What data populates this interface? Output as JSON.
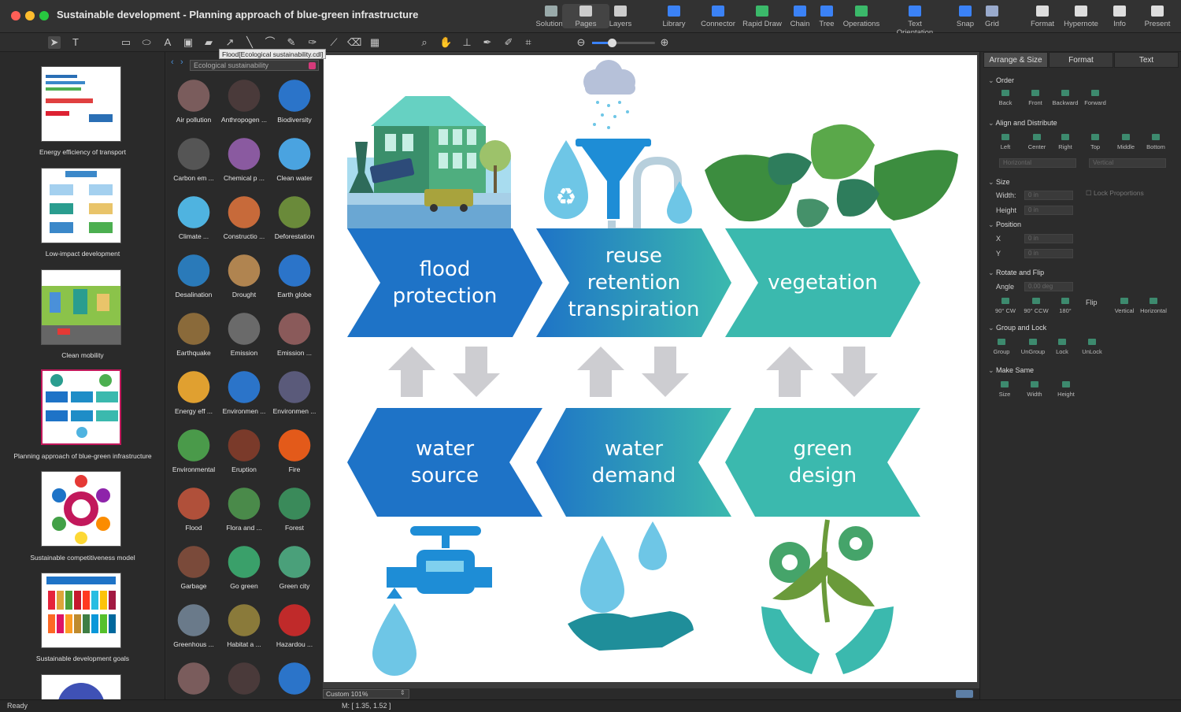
{
  "window": {
    "title": "Sustainable development - Planning approach of blue-green infrastructure"
  },
  "toolbar": {
    "items": [
      "Solutions",
      "Pages",
      "Layers",
      "Library",
      "Connector",
      "Rapid Draw",
      "Chain",
      "Tree",
      "Operations",
      "Text Orientation",
      "Snap",
      "Grid",
      "Format",
      "Hypernote",
      "Info",
      "Present"
    ]
  },
  "tooltip": "Flood[Ecological sustainability.cdl]",
  "pages": [
    "Energy efficiency of transport",
    "Low-impact development",
    "Clean mobility",
    "Planning approach of blue-green infrastructure",
    "Sustainable competitiveness model",
    "Sustainable development goals"
  ],
  "library": {
    "name": "Ecological sustainability",
    "items": [
      "Air pollution",
      "Anthropogen ...",
      "Biodiversity",
      "Carbon em ...",
      "Chemical p ...",
      "Clean water",
      "Climate ...",
      "Constructio ...",
      "Deforestation",
      "Desalination",
      "Drought",
      "Earth globe",
      "Earthquake",
      "Emission",
      "Emission ...",
      "Energy eff ...",
      "Environmen ...",
      "Environmen ...",
      "Environmental",
      "Eruption",
      "Fire",
      "Flood",
      "Flora and ...",
      "Forest",
      "Garbage",
      "Go green",
      "Green city",
      "Greenhous ...",
      "Habitat a ...",
      "Hazardou ..."
    ]
  },
  "diagram": {
    "top": [
      "flood\nprotection",
      "reuse\nretention\ntranspiration",
      "vegetation"
    ],
    "bottom": [
      "water\nsource",
      "water\ndemand",
      "green\ndesign"
    ]
  },
  "inspector": {
    "tabs": [
      "Arrange & Size",
      "Format",
      "Text"
    ],
    "order": {
      "title": "Order",
      "buttons": [
        "Back",
        "Front",
        "Backward",
        "Forward"
      ]
    },
    "align": {
      "title": "Align and Distribute",
      "buttons": [
        "Left",
        "Center",
        "Right",
        "Top",
        "Middle",
        "Bottom"
      ],
      "horizontal": "Horizontal",
      "vertical": "Vertical"
    },
    "size": {
      "title": "Size",
      "width_label": "Width:",
      "height_label": "Height",
      "width": "0 in",
      "height": "0 in",
      "lock": "Lock Proportions"
    },
    "position": {
      "title": "Position",
      "x_label": "X",
      "y_label": "Y",
      "x": "0 in",
      "y": "0 in"
    },
    "rotate": {
      "title": "Rotate and Flip",
      "angle_label": "Angle",
      "angle": "0.00 deg",
      "buttons": [
        "90° CW",
        "90° CCW",
        "180°"
      ],
      "flip": "Flip",
      "flip_buttons": [
        "Vertical",
        "Horizontal"
      ]
    },
    "group": {
      "title": "Group and Lock",
      "buttons": [
        "Group",
        "UnGroup",
        "Lock",
        "UnLock"
      ]
    },
    "same": {
      "title": "Make Same",
      "buttons": [
        "Size",
        "Width",
        "Height"
      ]
    }
  },
  "zoom": "Custom 101%",
  "status": {
    "left": "Ready",
    "mouse": "M: [ 1.35, 1.52 ]"
  },
  "colors": {
    "blue": "#1e73c7",
    "teal": "#3bb9ae",
    "gray_arrow": "#cdcdd1"
  }
}
